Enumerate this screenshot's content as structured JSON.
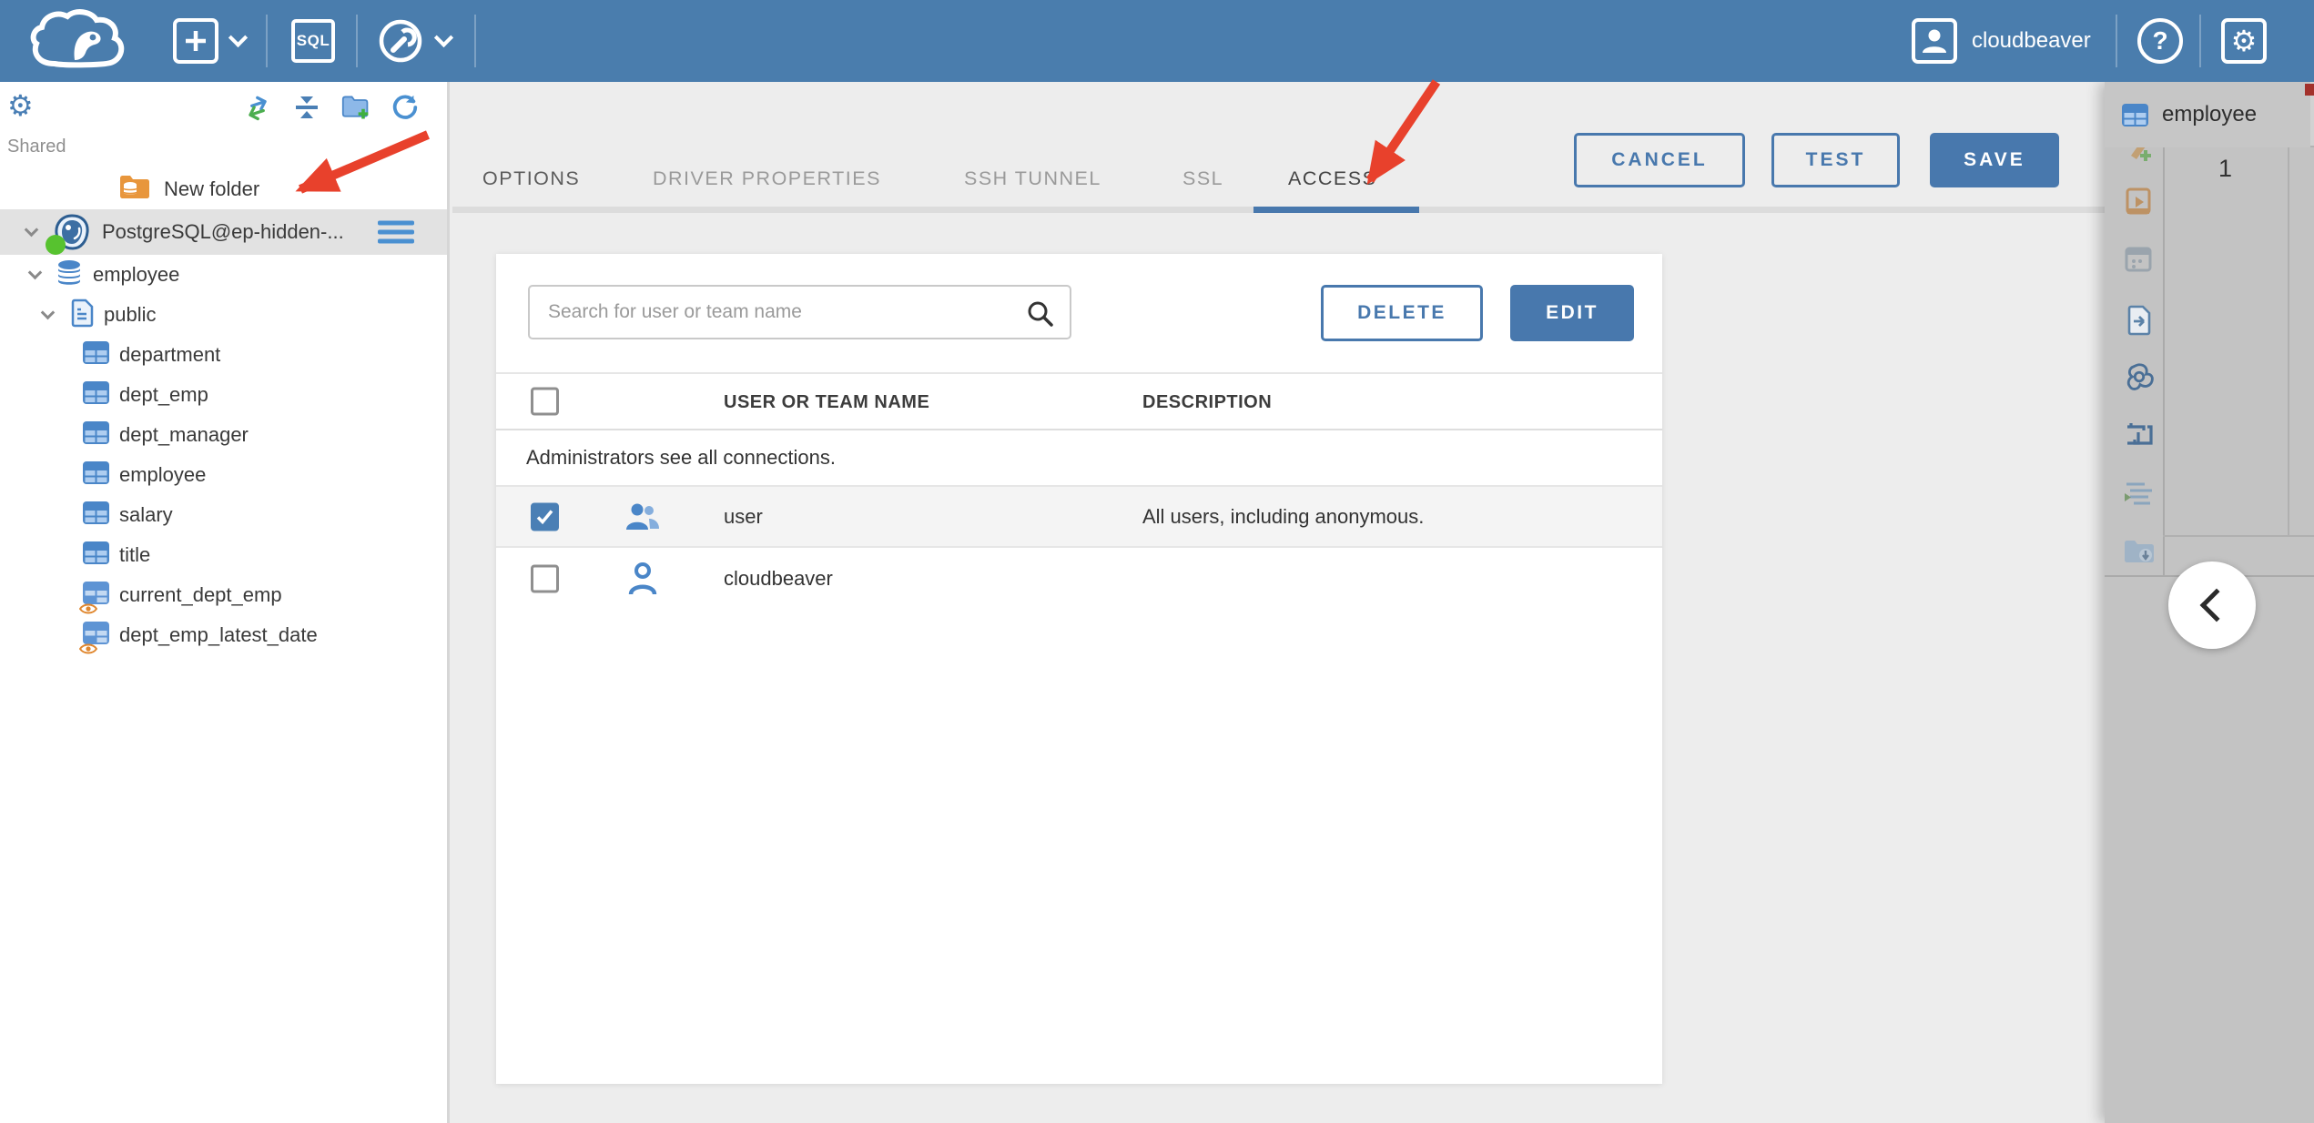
{
  "topbar": {
    "user_label": "cloudbeaver",
    "sql_label": "SQL",
    "help_glyph": "?",
    "settings_glyph": "⚙"
  },
  "sidebar": {
    "settings_glyph": "⚙",
    "section_label": "Shared",
    "tree": [
      {
        "label": "New folder",
        "type": "folder"
      },
      {
        "label": "PostgreSQL@ep-hidden-...",
        "type": "postgres-connection",
        "selected": true,
        "expanded": true,
        "status": "connected"
      },
      {
        "label": "employee",
        "type": "database",
        "expanded": true
      },
      {
        "label": "public",
        "type": "schema",
        "expanded": true
      },
      {
        "label": "department",
        "type": "table"
      },
      {
        "label": "dept_emp",
        "type": "table"
      },
      {
        "label": "dept_manager",
        "type": "table"
      },
      {
        "label": "employee",
        "type": "table"
      },
      {
        "label": "salary",
        "type": "table"
      },
      {
        "label": "title",
        "type": "table"
      },
      {
        "label": "current_dept_emp",
        "type": "view"
      },
      {
        "label": "dept_emp_latest_date",
        "type": "view"
      }
    ]
  },
  "dialog": {
    "tabs": [
      {
        "label": "OPTIONS"
      },
      {
        "label": "DRIVER PROPERTIES"
      },
      {
        "label": "SSH TUNNEL"
      },
      {
        "label": "SSL"
      },
      {
        "label": "ACCESS",
        "active": true
      }
    ],
    "actions": [
      {
        "label": "CANCEL"
      },
      {
        "label": "TEST"
      },
      {
        "label": "SAVE",
        "primary": true
      }
    ],
    "toolbar": {
      "search_placeholder": "Search for user or team name",
      "delete_label": "DELETE",
      "edit_label": "EDIT"
    },
    "table": {
      "columns": [
        "USER OR TEAM NAME",
        "DESCRIPTION"
      ],
      "info_row": "Administrators see all connections.",
      "rows": [
        {
          "name": "user",
          "description": "All users, including anonymous.",
          "checked": true,
          "icon": "team"
        },
        {
          "name": "cloudbeaver",
          "description": "",
          "checked": false,
          "icon": "user"
        }
      ]
    }
  },
  "right_panel": {
    "tab_label": "employee",
    "row_number": "1"
  },
  "colors": {
    "topbar_blue": "#4a7dad",
    "accent_blue": "#4878ad",
    "icon_blue": "#4a86c8",
    "status_green": "#57c22f",
    "arrow_red": "#e8412c",
    "row_highlight": "#f4f4f4",
    "panel_gray": "#c3c3c3"
  }
}
